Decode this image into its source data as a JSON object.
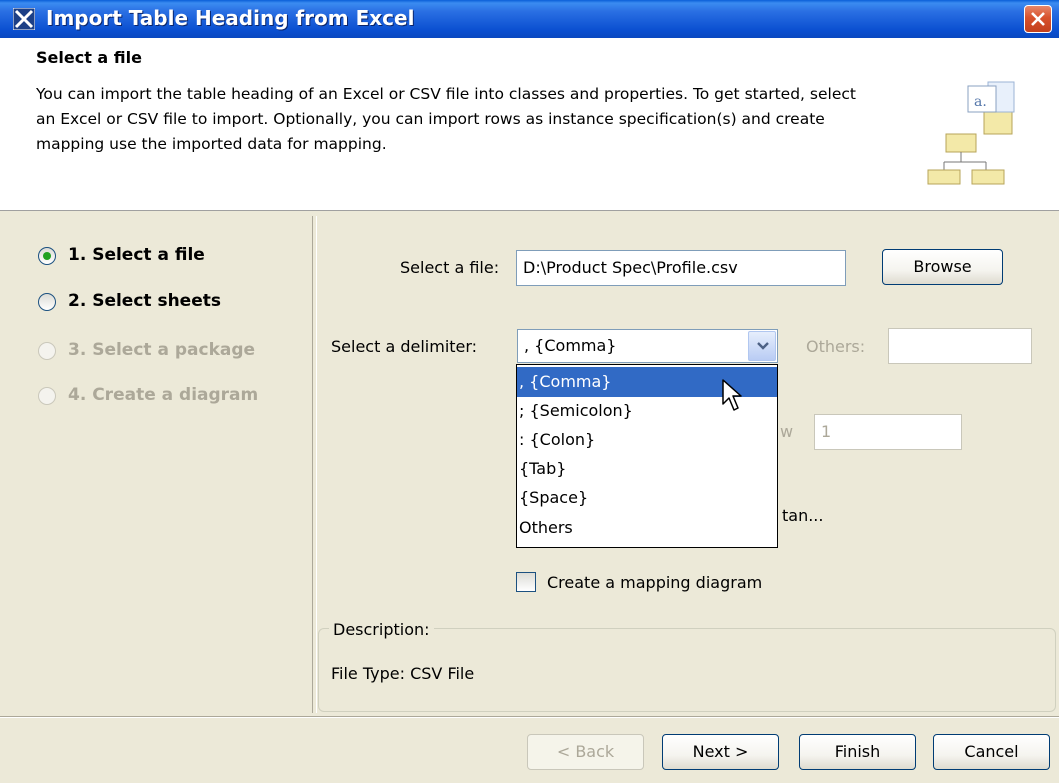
{
  "window": {
    "title": "Import Table Heading from Excel"
  },
  "header": {
    "title": "Select a file",
    "description": "You can import the table heading of an Excel or CSV file into classes and properties. To get started, select an Excel or CSV file to import. Optionally, you can import rows as instance specification(s) and create mapping use the imported data for mapping."
  },
  "steps": [
    {
      "label": "1. Select a file",
      "state": "selected"
    },
    {
      "label": "2. Select sheets",
      "state": "enabled"
    },
    {
      "label": "3. Select a package",
      "state": "disabled"
    },
    {
      "label": "4. Create a diagram",
      "state": "disabled"
    }
  ],
  "form": {
    "file_label": "Select a file:",
    "file_value": "D:\\Product Spec\\Profile.csv",
    "browse_label": "Browse",
    "delimiter_label": "Select a delimiter:",
    "delimiter_value": ", {Comma}",
    "others_label": "Others:",
    "others_value": "",
    "row_label_fragment": "w",
    "row_value": "1",
    "hidden_option_fragment": "tan...",
    "mapping_checkbox_label": "Create a mapping diagram",
    "mapping_checked": false
  },
  "dropdown": {
    "options": [
      ", {Comma}",
      "; {Semicolon}",
      ": {Colon}",
      "{Tab}",
      "{Space}",
      "Others"
    ],
    "highlighted": ", {Comma}"
  },
  "description": {
    "title": "Description:",
    "text": "File Type: CSV File"
  },
  "buttons": {
    "back": "< Back",
    "next": "Next >",
    "finish": "Finish",
    "cancel": "Cancel"
  },
  "colors": {
    "titlebar": "#0a4fd0",
    "selection": "#316ac5",
    "dialog_bg": "#ece9d8",
    "radio_dot": "#21a121"
  }
}
